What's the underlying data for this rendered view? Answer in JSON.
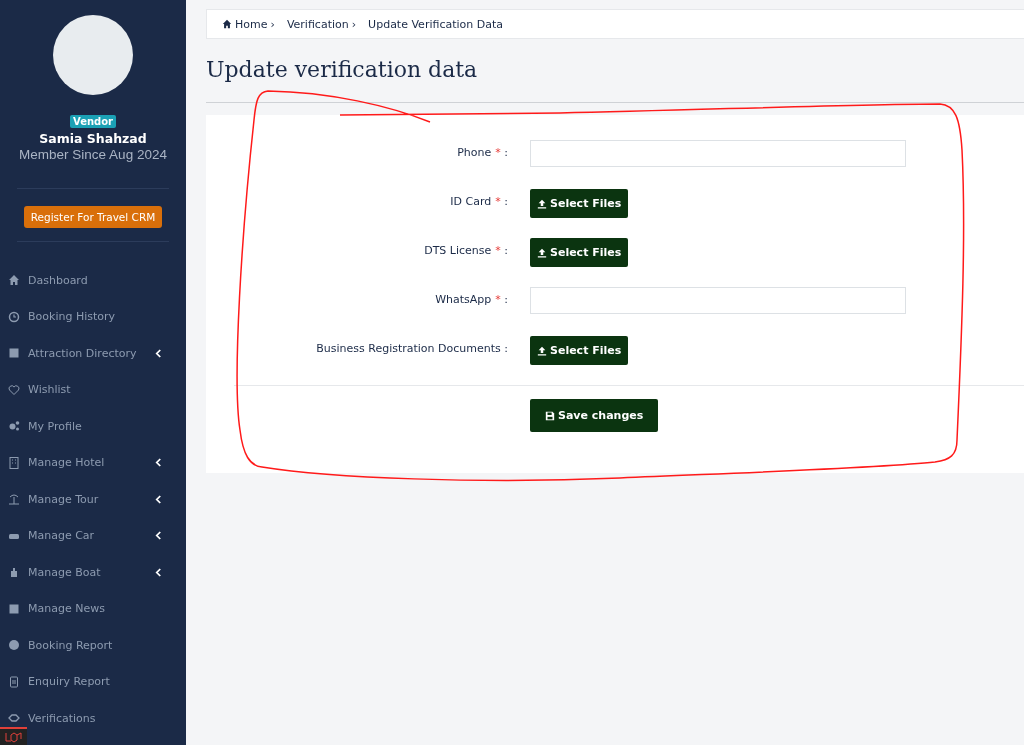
{
  "sidebar": {
    "badge": "Vendor",
    "user_name": "Samia Shahzad",
    "member_since": "Member Since Aug 2024",
    "register_button": "Register For Travel CRM",
    "items": [
      {
        "label": "Dashboard",
        "has_submenu": false
      },
      {
        "label": "Booking History",
        "has_submenu": false
      },
      {
        "label": "Attraction Directory",
        "has_submenu": true
      },
      {
        "label": "Wishlist",
        "has_submenu": false
      },
      {
        "label": "My Profile",
        "has_submenu": false
      },
      {
        "label": "Manage Hotel",
        "has_submenu": true
      },
      {
        "label": "Manage Tour",
        "has_submenu": true
      },
      {
        "label": "Manage Car",
        "has_submenu": true
      },
      {
        "label": "Manage Boat",
        "has_submenu": true
      },
      {
        "label": "Manage News",
        "has_submenu": false
      },
      {
        "label": "Booking Report",
        "has_submenu": false
      },
      {
        "label": "Enquiry Report",
        "has_submenu": false
      },
      {
        "label": "Verifications",
        "has_submenu": false
      }
    ]
  },
  "breadcrumb": [
    {
      "label": "Home",
      "separator": "›"
    },
    {
      "label": "Verification",
      "separator": "›"
    },
    {
      "label": "Update Verification Data"
    }
  ],
  "page_title": "Update verification data",
  "form": {
    "fields": [
      {
        "kind": "text",
        "label": "Phone",
        "required_mark": "*",
        "colon": ":"
      },
      {
        "kind": "file",
        "label": "ID Card",
        "required_mark": "*",
        "colon": ":",
        "button": "Select Files"
      },
      {
        "kind": "file",
        "label": "DTS License",
        "required_mark": "*",
        "colon": ":",
        "button": "Select Files"
      },
      {
        "kind": "text",
        "label": "WhatsApp",
        "required_mark": "*",
        "colon": ":"
      },
      {
        "kind": "file",
        "label": "Business Registration Documents",
        "colon": ":",
        "button": "Select Files"
      }
    ],
    "save_button": "Save changes"
  }
}
